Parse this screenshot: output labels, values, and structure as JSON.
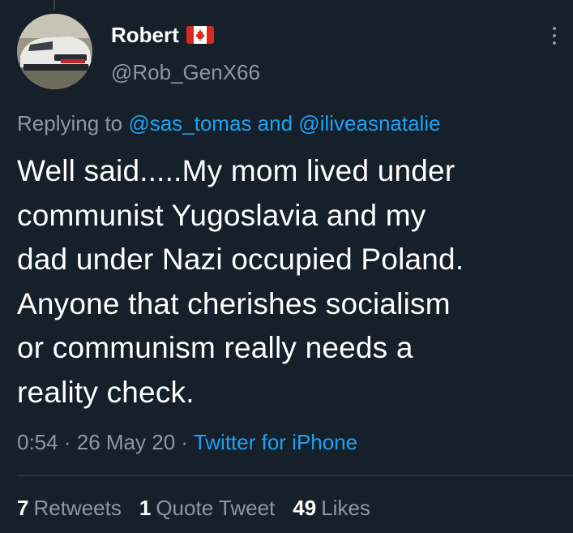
{
  "tweet": {
    "author": {
      "display_name": "Robert",
      "flag": "canada-flag",
      "handle": "@Rob_GenX66"
    },
    "replying": {
      "prefix": "Replying to",
      "mention_1": "@sas_tomas",
      "conjunction": "and",
      "mention_2": "@iliveasnatalie"
    },
    "text": "Well said.....My mom lived under\ncommunist Yugoslavia and my\ndad under Nazi occupied Poland.\nAnyone that cherishes socialism\nor communism really needs a\nreality check.",
    "time": "0:54",
    "separator": "·",
    "date": "26 May 20",
    "source": "Twitter for iPhone",
    "stats": {
      "retweets_count": "7",
      "retweets_label": "Retweets",
      "quotes_count": "1",
      "quotes_label": "Quote Tweet",
      "likes_count": "49",
      "likes_label": "Likes"
    }
  },
  "colors": {
    "background": "#15202b",
    "text_primary": "#ffffff",
    "text_secondary": "#8899a6",
    "link": "#1da1f2",
    "divider": "#38444d",
    "flag_red": "#d52b1e"
  }
}
